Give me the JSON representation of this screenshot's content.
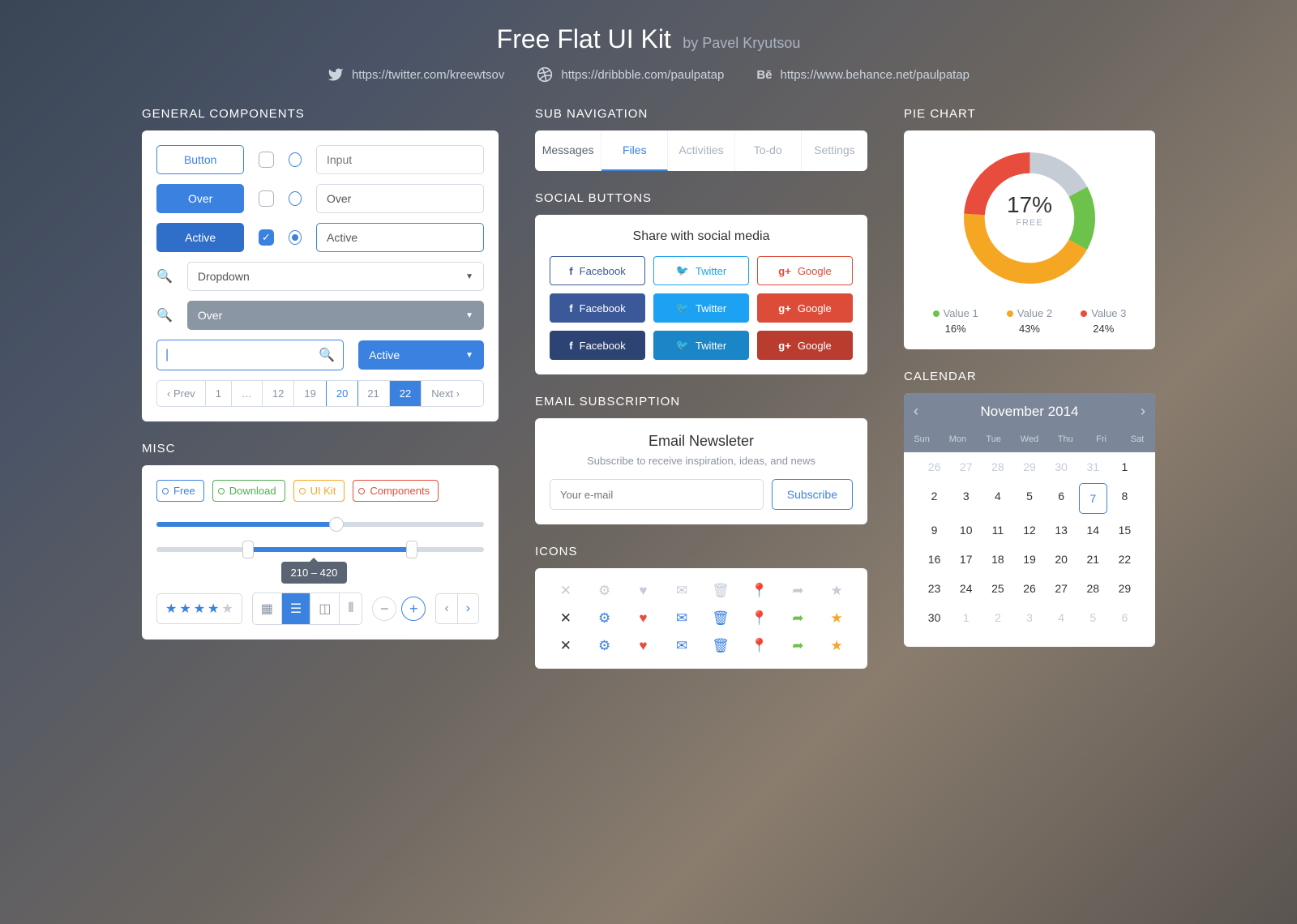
{
  "header": {
    "title": "Free Flat UI Kit",
    "author": "by Pavel Kryutsou",
    "links": {
      "twitter": "https://twitter.com/kreewtsov",
      "dribbble": "https://dribbble.com/paulpatap",
      "behance": "https://www.behance.net/paulpatap"
    }
  },
  "sections": {
    "general": "GENERAL COMPONENTS",
    "misc": "MISC",
    "subnav": "SUB NAVIGATION",
    "social": "SOCIAL BUTTONS",
    "email": "EMAIL SUBSCRIPTION",
    "icons": "ICONS",
    "pie": "PIE CHART",
    "calendar": "CALENDAR"
  },
  "general": {
    "buttons": [
      "Button",
      "Over",
      "Active"
    ],
    "inputs": {
      "placeholder": "Input",
      "over": "Over",
      "active": "Active"
    },
    "dropdowns": [
      "Dropdown",
      "Over",
      "Active"
    ],
    "pagination": {
      "prev": "Prev",
      "next": "Next",
      "pages": [
        "1",
        "…",
        "12",
        "19",
        "20",
        "21",
        "22"
      ]
    }
  },
  "misc": {
    "tags": [
      "Free",
      "Download",
      "UI Kit",
      "Components"
    ],
    "range_label": "210 – 420"
  },
  "subnav": {
    "items": [
      "Messages",
      "Files",
      "Activities",
      "To-do",
      "Settings"
    ]
  },
  "social": {
    "title": "Share with social media",
    "fb": "Facebook",
    "tw": "Twitter",
    "gp": "Google"
  },
  "email": {
    "title": "Email Newsleter",
    "subtitle": "Subscribe to receive inspiration, ideas, and news",
    "placeholder": "Your e-mail",
    "button": "Subscribe"
  },
  "pie": {
    "center_value": "17%",
    "center_label": "FREE",
    "legend": [
      {
        "name": "Value 1",
        "value": "16%",
        "color": "#6cc24a"
      },
      {
        "name": "Value 2",
        "value": "43%",
        "color": "#f5a623"
      },
      {
        "name": "Value 3",
        "value": "24%",
        "color": "#e74c3c"
      }
    ]
  },
  "calendar": {
    "month": "November 2014",
    "dowh": [
      "Sun",
      "Mon",
      "Tue",
      "Wed",
      "Thu",
      "Fri",
      "Sat"
    ],
    "days": [
      {
        "d": "26",
        "m": 1
      },
      {
        "d": "27",
        "m": 1
      },
      {
        "d": "28",
        "m": 1
      },
      {
        "d": "29",
        "m": 1
      },
      {
        "d": "30",
        "m": 1
      },
      {
        "d": "31",
        "m": 1
      },
      {
        "d": "1"
      },
      {
        "d": "2"
      },
      {
        "d": "3"
      },
      {
        "d": "4"
      },
      {
        "d": "5"
      },
      {
        "d": "6"
      },
      {
        "d": "7",
        "t": 1
      },
      {
        "d": "8"
      },
      {
        "d": "9"
      },
      {
        "d": "10"
      },
      {
        "d": "11"
      },
      {
        "d": "12"
      },
      {
        "d": "13"
      },
      {
        "d": "14"
      },
      {
        "d": "15"
      },
      {
        "d": "16"
      },
      {
        "d": "17"
      },
      {
        "d": "18"
      },
      {
        "d": "19"
      },
      {
        "d": "20"
      },
      {
        "d": "21"
      },
      {
        "d": "22"
      },
      {
        "d": "23"
      },
      {
        "d": "24"
      },
      {
        "d": "25"
      },
      {
        "d": "26"
      },
      {
        "d": "27"
      },
      {
        "d": "28"
      },
      {
        "d": "29"
      },
      {
        "d": "30"
      },
      {
        "d": "1",
        "m": 1
      },
      {
        "d": "2",
        "m": 1
      },
      {
        "d": "3",
        "m": 1
      },
      {
        "d": "4",
        "m": 1
      },
      {
        "d": "5",
        "m": 1
      },
      {
        "d": "6",
        "m": 1
      }
    ]
  },
  "chart_data": {
    "type": "pie",
    "title": "PIE CHART",
    "series": [
      {
        "name": "Value 1",
        "value": 16,
        "color": "#6cc24a"
      },
      {
        "name": "Value 2",
        "value": 43,
        "color": "#f5a623"
      },
      {
        "name": "Value 3",
        "value": 24,
        "color": "#e74c3c"
      },
      {
        "name": "Free",
        "value": 17,
        "color": "#c5ccd6"
      }
    ],
    "center_label": "17% FREE"
  }
}
